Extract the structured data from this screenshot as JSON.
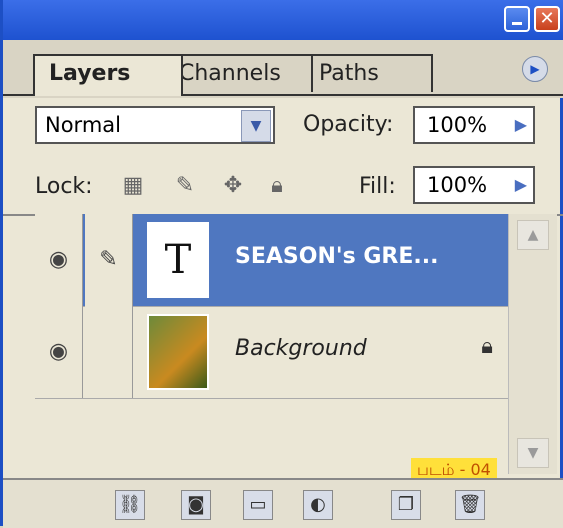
{
  "tabs": [
    "Layers",
    "Channels",
    "Paths"
  ],
  "blend_mode": "Normal",
  "opacity": {
    "label": "Opacity:",
    "value": "100%"
  },
  "lock_label": "Lock:",
  "fill": {
    "label": "Fill:",
    "value": "100%"
  },
  "layers": [
    {
      "name": "SEASON's GRE...",
      "thumb_text": "T",
      "visible": true,
      "selected": true
    },
    {
      "name": "Background",
      "visible": true,
      "locked": true
    }
  ],
  "caption": "படம் - 04",
  "icons": {
    "window": [
      "minimize-icon",
      "close-icon"
    ],
    "lock": [
      "lock-transparent-icon",
      "lock-image-icon",
      "lock-position-icon",
      "lock-all-icon"
    ],
    "bottom": [
      "link-layers-icon",
      "add-mask-icon",
      "new-group-icon",
      "adjustment-layer-icon",
      "new-layer-icon",
      "delete-layer-icon"
    ]
  },
  "colors": {
    "title_bar": "#1e52d0",
    "selection": "#4f77c0",
    "caption_bg": "#ffe03a"
  }
}
